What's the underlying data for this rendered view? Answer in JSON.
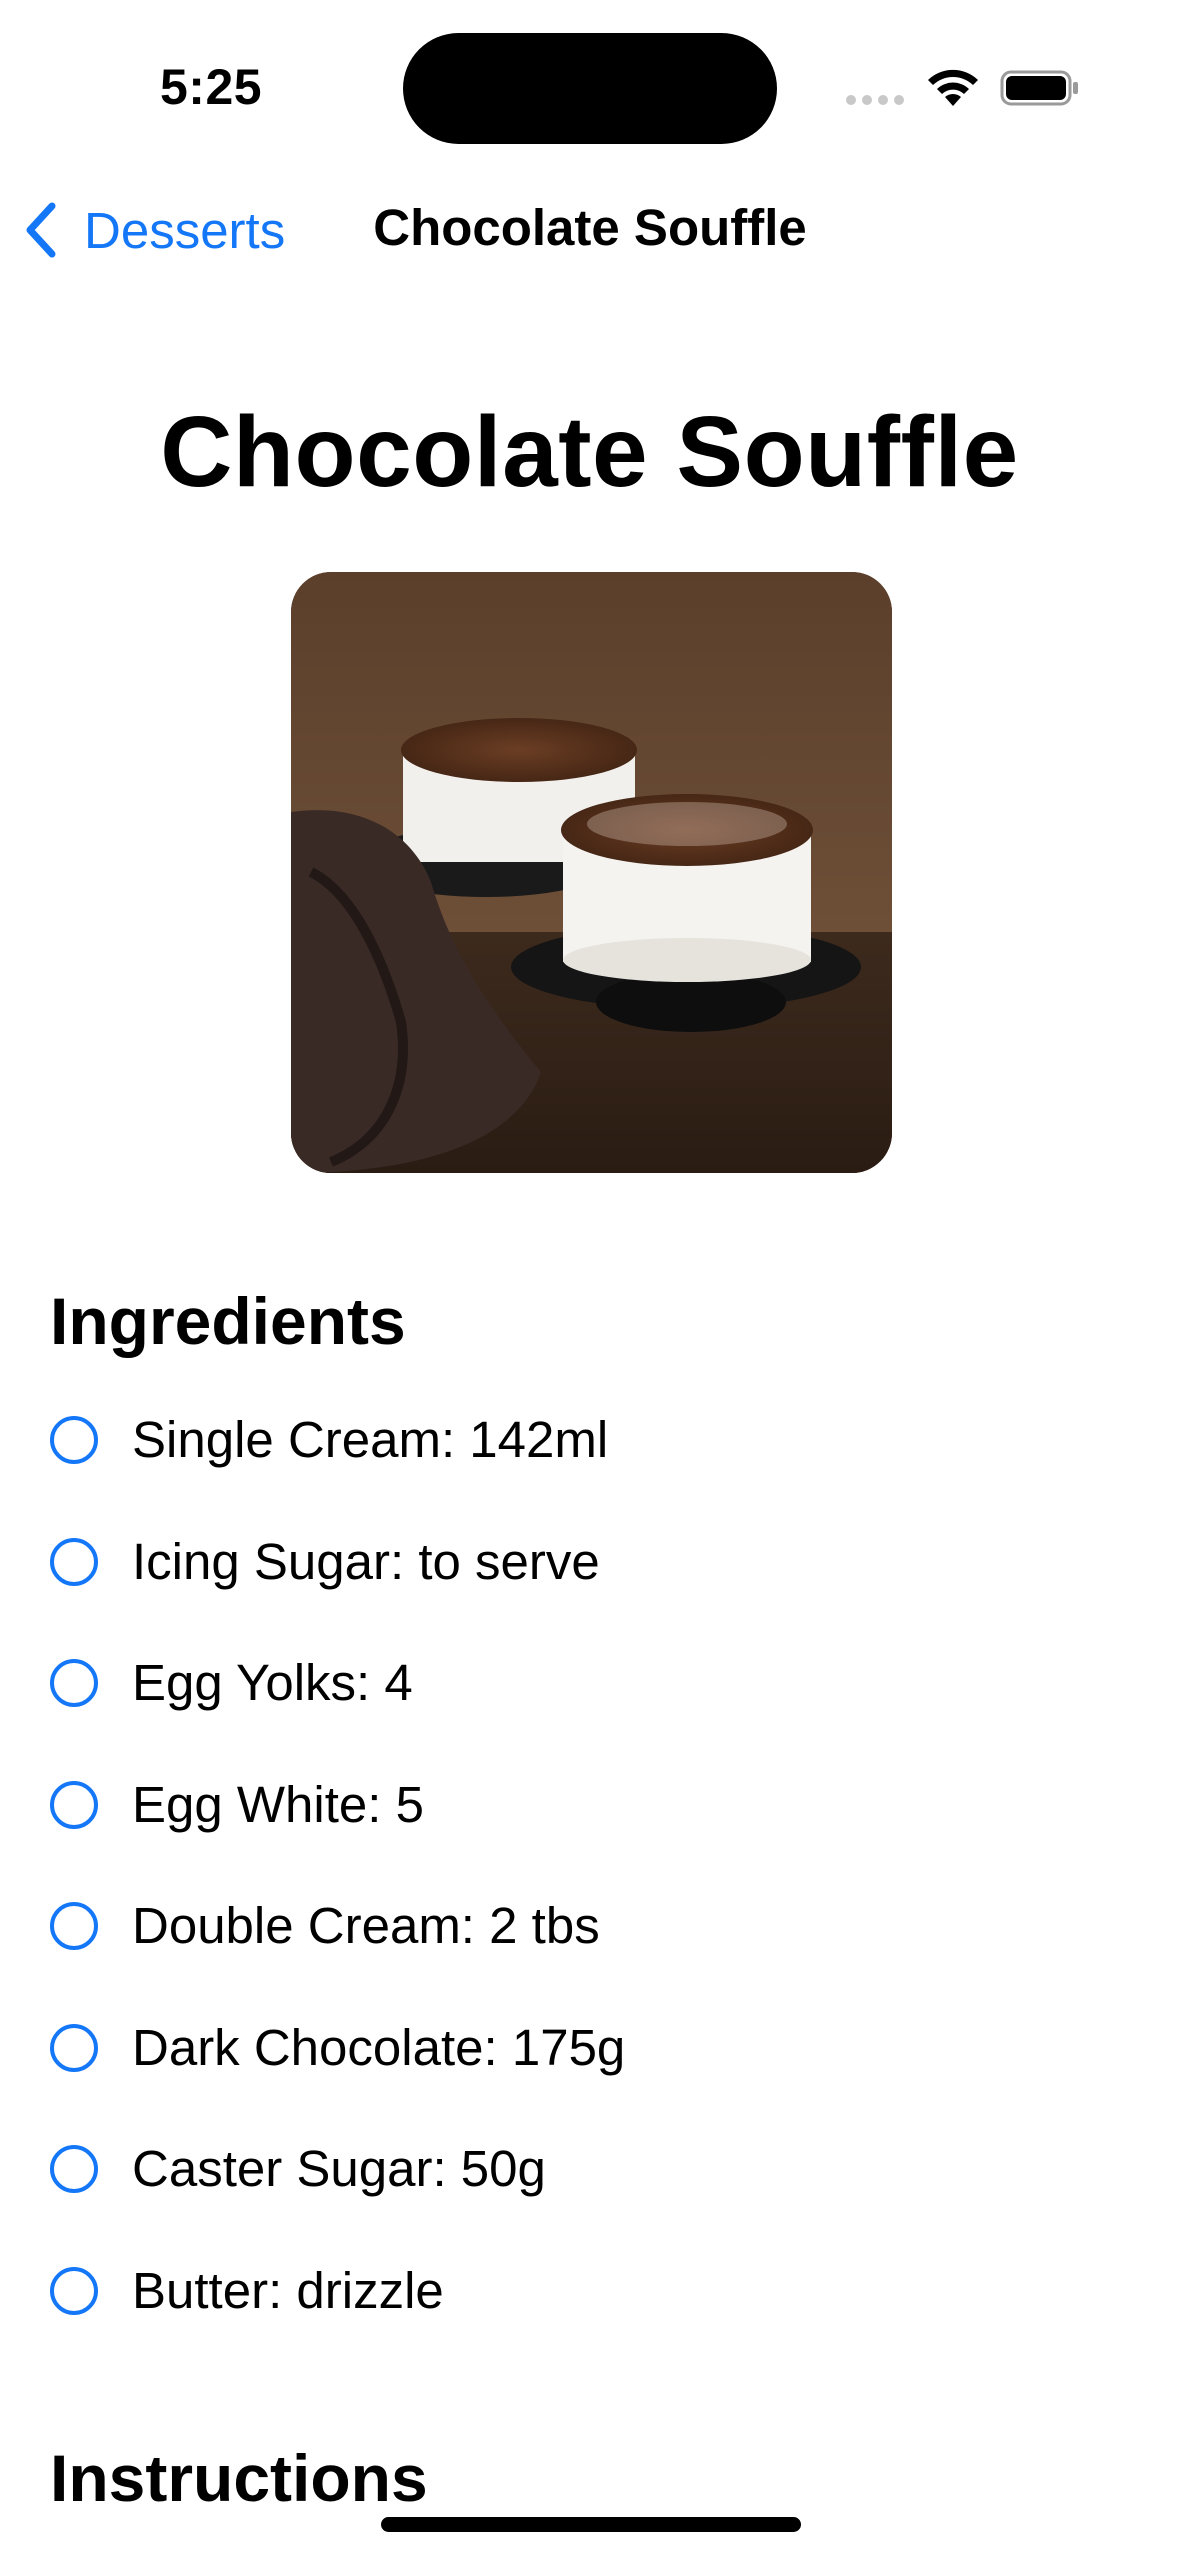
{
  "status_bar": {
    "time": "5:25"
  },
  "nav": {
    "back_label": "Desserts",
    "title": "Chocolate Souffle"
  },
  "recipe": {
    "title": "Chocolate Souffle",
    "image_subject": "two chocolate souffles in white ramekins on a dark wooden table"
  },
  "ingredients": {
    "heading": "Ingredients",
    "items": [
      {
        "label": "Single Cream: 142ml",
        "checked": false
      },
      {
        "label": "Icing Sugar: to serve",
        "checked": false
      },
      {
        "label": "Egg Yolks: 4",
        "checked": false
      },
      {
        "label": "Egg White: 5",
        "checked": false
      },
      {
        "label": "Double Cream: 2 tbs",
        "checked": false
      },
      {
        "label": "Dark Chocolate: 175g",
        "checked": false
      },
      {
        "label": "Caster Sugar: 50g",
        "checked": false
      },
      {
        "label": "Butter: drizzle",
        "checked": false
      }
    ]
  },
  "instructions": {
    "heading": "Instructions"
  },
  "icons": {
    "back": "chevron-left-icon",
    "wifi": "wifi-icon",
    "battery": "battery-icon",
    "signal": "cellular-signal-icon",
    "checkbox": "circle-outline-icon"
  },
  "colors": {
    "accent": "#1477f8",
    "text": "#000000",
    "background": "#ffffff"
  }
}
